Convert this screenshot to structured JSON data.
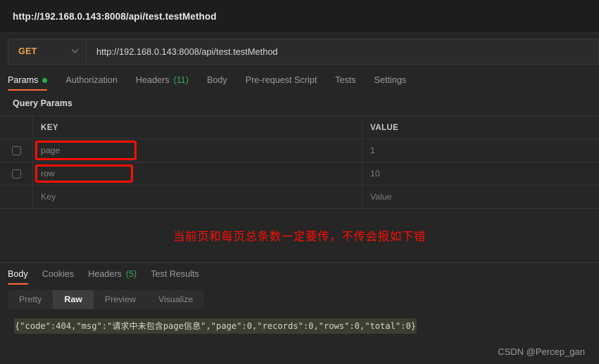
{
  "window": {
    "title": "http://192.168.0.143:8008/api/test.testMethod"
  },
  "request": {
    "method": "GET",
    "method_chevron_icon": "chevron-down-icon",
    "url": "http://192.168.0.143:8008/api/test.testMethod",
    "tabs": [
      {
        "label": "Params",
        "badge": "",
        "indicator": "dot-green",
        "active": true
      },
      {
        "label": "Authorization",
        "badge": "",
        "indicator": "",
        "active": false
      },
      {
        "label": "Headers",
        "badge": "(11)",
        "indicator": "",
        "active": false
      },
      {
        "label": "Body",
        "badge": "",
        "indicator": "",
        "active": false
      },
      {
        "label": "Pre-request Script",
        "badge": "",
        "indicator": "",
        "active": false
      },
      {
        "label": "Tests",
        "badge": "",
        "indicator": "",
        "active": false
      },
      {
        "label": "Settings",
        "badge": "",
        "indicator": "",
        "active": false
      }
    ]
  },
  "query_params": {
    "section_label": "Query Params",
    "columns": {
      "key": "KEY",
      "value": "VALUE"
    },
    "rows": [
      {
        "checked": false,
        "key": "page",
        "value": "1",
        "highlighted": true
      },
      {
        "checked": false,
        "key": "row",
        "value": "10",
        "highlighted": true
      },
      {
        "checked": false,
        "key": "Key",
        "value": "Value",
        "highlighted": false
      }
    ]
  },
  "annotation": {
    "text": "当前页和每页总条数一定要传，不传会报如下错",
    "color": "#fa0f05"
  },
  "response": {
    "tabs": [
      {
        "label": "Body",
        "badge": "",
        "active": true
      },
      {
        "label": "Cookies",
        "badge": "",
        "active": false
      },
      {
        "label": "Headers",
        "badge": "(5)",
        "active": false
      },
      {
        "label": "Test Results",
        "badge": "",
        "active": false
      }
    ],
    "format_buttons": [
      {
        "label": "Pretty",
        "active": false
      },
      {
        "label": "Raw",
        "active": true
      },
      {
        "label": "Preview",
        "active": false
      },
      {
        "label": "Visualize",
        "active": false
      }
    ],
    "body_raw": "{\"code\":404,\"msg\":\"请求中未包含page信息\",\"page\":0,\"records\":0,\"rows\":0,\"total\":0}"
  },
  "watermark": {
    "text": "CSDN @Percep_gan"
  },
  "colors": {
    "accent": "#ff6c37",
    "method": "#f0a04b",
    "annotation_red": "#fa0f05",
    "green_badge": "#3aa757",
    "code_highlight": "#3d3d31"
  }
}
